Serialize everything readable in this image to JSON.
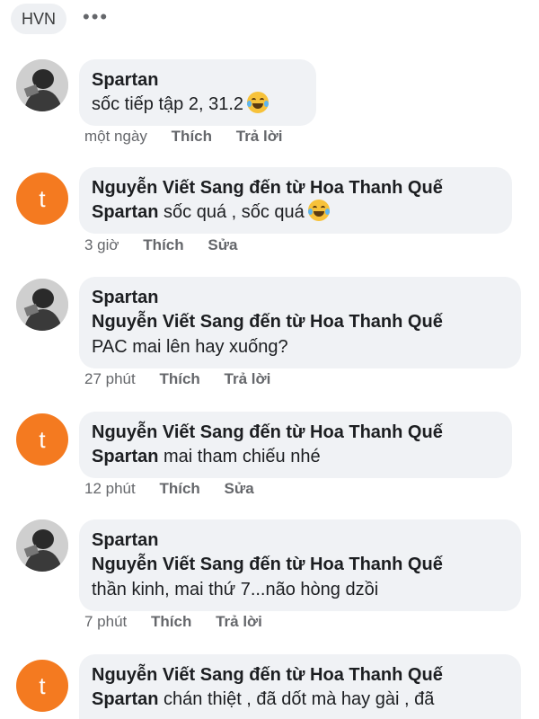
{
  "topbar": {
    "chip_label": "HVN",
    "more_label": "•••"
  },
  "comments": [
    {
      "author": "Spartan",
      "lines": [
        {
          "text": "sốc tiếp tập 2, 31.2"
        }
      ],
      "time": "một ngày",
      "like": "Thích",
      "action": "Trả lời",
      "avatar": "photo"
    },
    {
      "author": "Nguyễn Viết Sang đến từ Hoa Thanh Quế",
      "lines": [
        {
          "mention": "Spartan",
          "text": " sốc quá , sốc quá"
        }
      ],
      "time": "3 giờ",
      "like": "Thích",
      "action": "Sửa",
      "avatar_letter": "t"
    },
    {
      "author": "Spartan",
      "lines": [
        {
          "mention": "Nguyễn Viết Sang đến từ Hoa Thanh Quế",
          "text": ""
        },
        {
          "text": "PAC mai lên hay xuống?"
        }
      ],
      "time": "27 phút",
      "like": "Thích",
      "action": "Trả lời",
      "avatar": "photo"
    },
    {
      "author": "Nguyễn Viết Sang đến từ Hoa Thanh Quế",
      "lines": [
        {
          "mention": "Spartan",
          "text": "  mai tham chiếu nhé"
        }
      ],
      "time": "12 phút",
      "like": "Thích",
      "action": "Sửa",
      "avatar_letter": "t"
    },
    {
      "author": "Spartan",
      "lines": [
        {
          "mention": "Nguyễn Viết Sang đến từ Hoa Thanh Quế",
          "text": ""
        },
        {
          "text": "thần kinh, mai thứ 7...não hòng dzồi"
        }
      ],
      "time": "7 phút",
      "like": "Thích",
      "action": "Trả lời",
      "avatar": "photo"
    },
    {
      "author": "Nguyễn Viết Sang đến từ Hoa Thanh Quế",
      "lines": [
        {
          "mention": "Spartan",
          "text": " chán thiệt , đã dốt mà hay gài , đã"
        }
      ],
      "avatar_letter": "t"
    }
  ],
  "colors": {
    "avatar_orange": "#f47a20",
    "bubble": "#f0f2f5",
    "meta_text": "#65676b"
  },
  "icons": {
    "emoji": "laughing-tears-emoji-icon",
    "more": "more-dots-icon"
  }
}
